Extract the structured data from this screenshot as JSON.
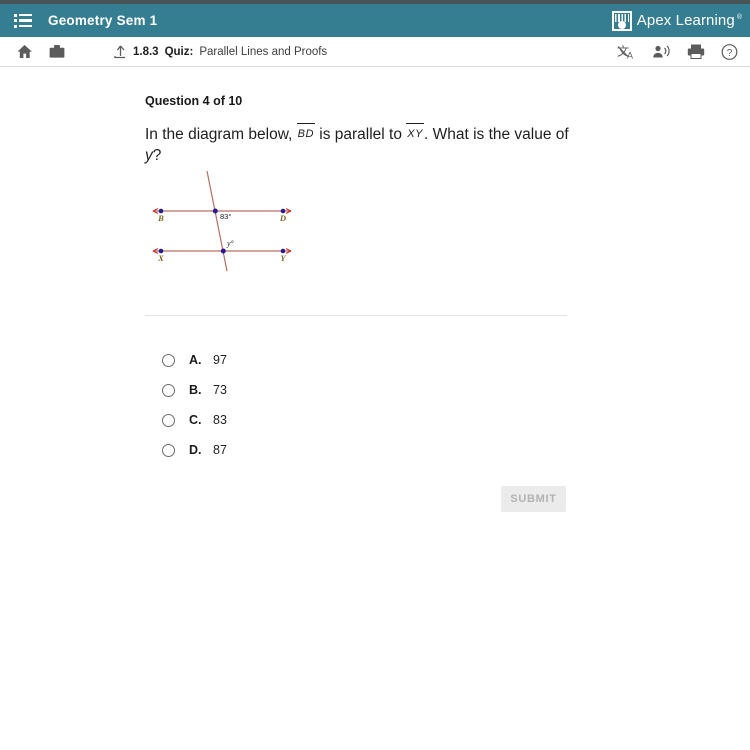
{
  "window": {
    "top_strip_color": "#4a5356"
  },
  "appbar": {
    "menu_icon": "list-menu-icon",
    "course_title": "Geometry Sem 1",
    "brand_name": "Apex Learning",
    "brand_tm": "®",
    "background_color": "#357d90"
  },
  "toolbar": {
    "home_icon": "home-icon",
    "briefcase_icon": "briefcase-icon",
    "upload_icon": "upload-arrow-icon",
    "breadcrumb": {
      "number": "1.8.3",
      "kind": "Quiz:",
      "name": "Parallel Lines and Proofs"
    },
    "translate_icon": "translate-icon",
    "read_aloud_icon": "read-aloud-icon",
    "print_icon": "print-icon",
    "help_icon": "help-circle-icon"
  },
  "question": {
    "counter": "Question 4 of 10",
    "text_part1": "In the diagram below,",
    "segment1": "BD",
    "text_part2": "is parallel to",
    "segment2": "XY",
    "text_part3": ". What is the value of",
    "variable": "y",
    "text_part4": "?"
  },
  "diagram": {
    "type": "parallel-lines-transversal",
    "line_color": "#b5705f",
    "point_color": "#2a1a8f",
    "label_color": "#8a6a1f",
    "top_line": {
      "left_label": "B",
      "right_label": "D"
    },
    "bottom_line": {
      "left_label": "X",
      "right_label": "Y"
    },
    "angles": [
      {
        "name": "top-angle",
        "label": "83°"
      },
      {
        "name": "bottom-angle",
        "label": "y°"
      }
    ]
  },
  "choices": [
    {
      "letter": "A.",
      "value": "97",
      "selected": false
    },
    {
      "letter": "B.",
      "value": "73",
      "selected": false
    },
    {
      "letter": "C.",
      "value": "83",
      "selected": false
    },
    {
      "letter": "D.",
      "value": "87",
      "selected": false
    }
  ],
  "submit": {
    "label": "SUBMIT",
    "disabled": true
  }
}
